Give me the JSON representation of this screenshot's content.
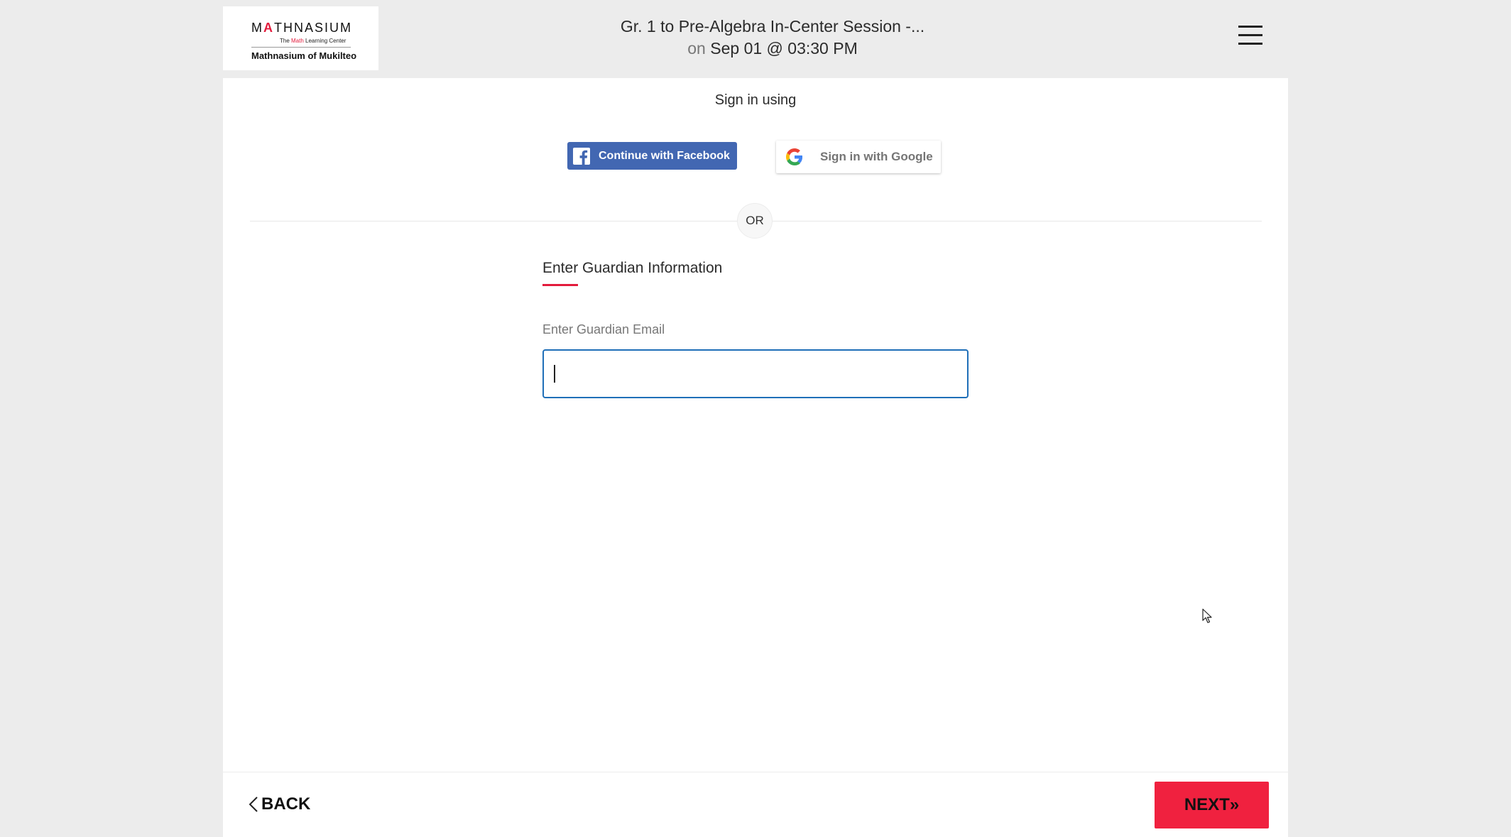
{
  "header": {
    "logo": {
      "word_prefix": "M",
      "word_accent": "A",
      "word_suffix": "THNASIUM",
      "tagline_prefix": "The ",
      "tagline_accent": "Math",
      "tagline_suffix": " Learning Center",
      "center_name": "Mathnasium of Mukilteo"
    },
    "session_title": "Gr. 1 to Pre-Algebra In-Center Session -...",
    "session_on": "on",
    "session_datetime": "Sep 01 @ 03:30 PM"
  },
  "signin": {
    "heading": "Sign in using",
    "facebook_label": "Continue with Facebook",
    "google_label": "Sign in with Google",
    "or_label": "OR"
  },
  "guardian": {
    "section_title": "Enter Guardian Information",
    "email_label": "Enter Guardian Email",
    "email_value": ""
  },
  "footer": {
    "back_label": "BACK",
    "next_label": "NEXT»"
  },
  "colors": {
    "accent": "#e31b3c",
    "next_button": "#f0213f",
    "facebook": "#4267b2",
    "input_focus": "#1f6fb8",
    "page_bg": "#ececec"
  }
}
